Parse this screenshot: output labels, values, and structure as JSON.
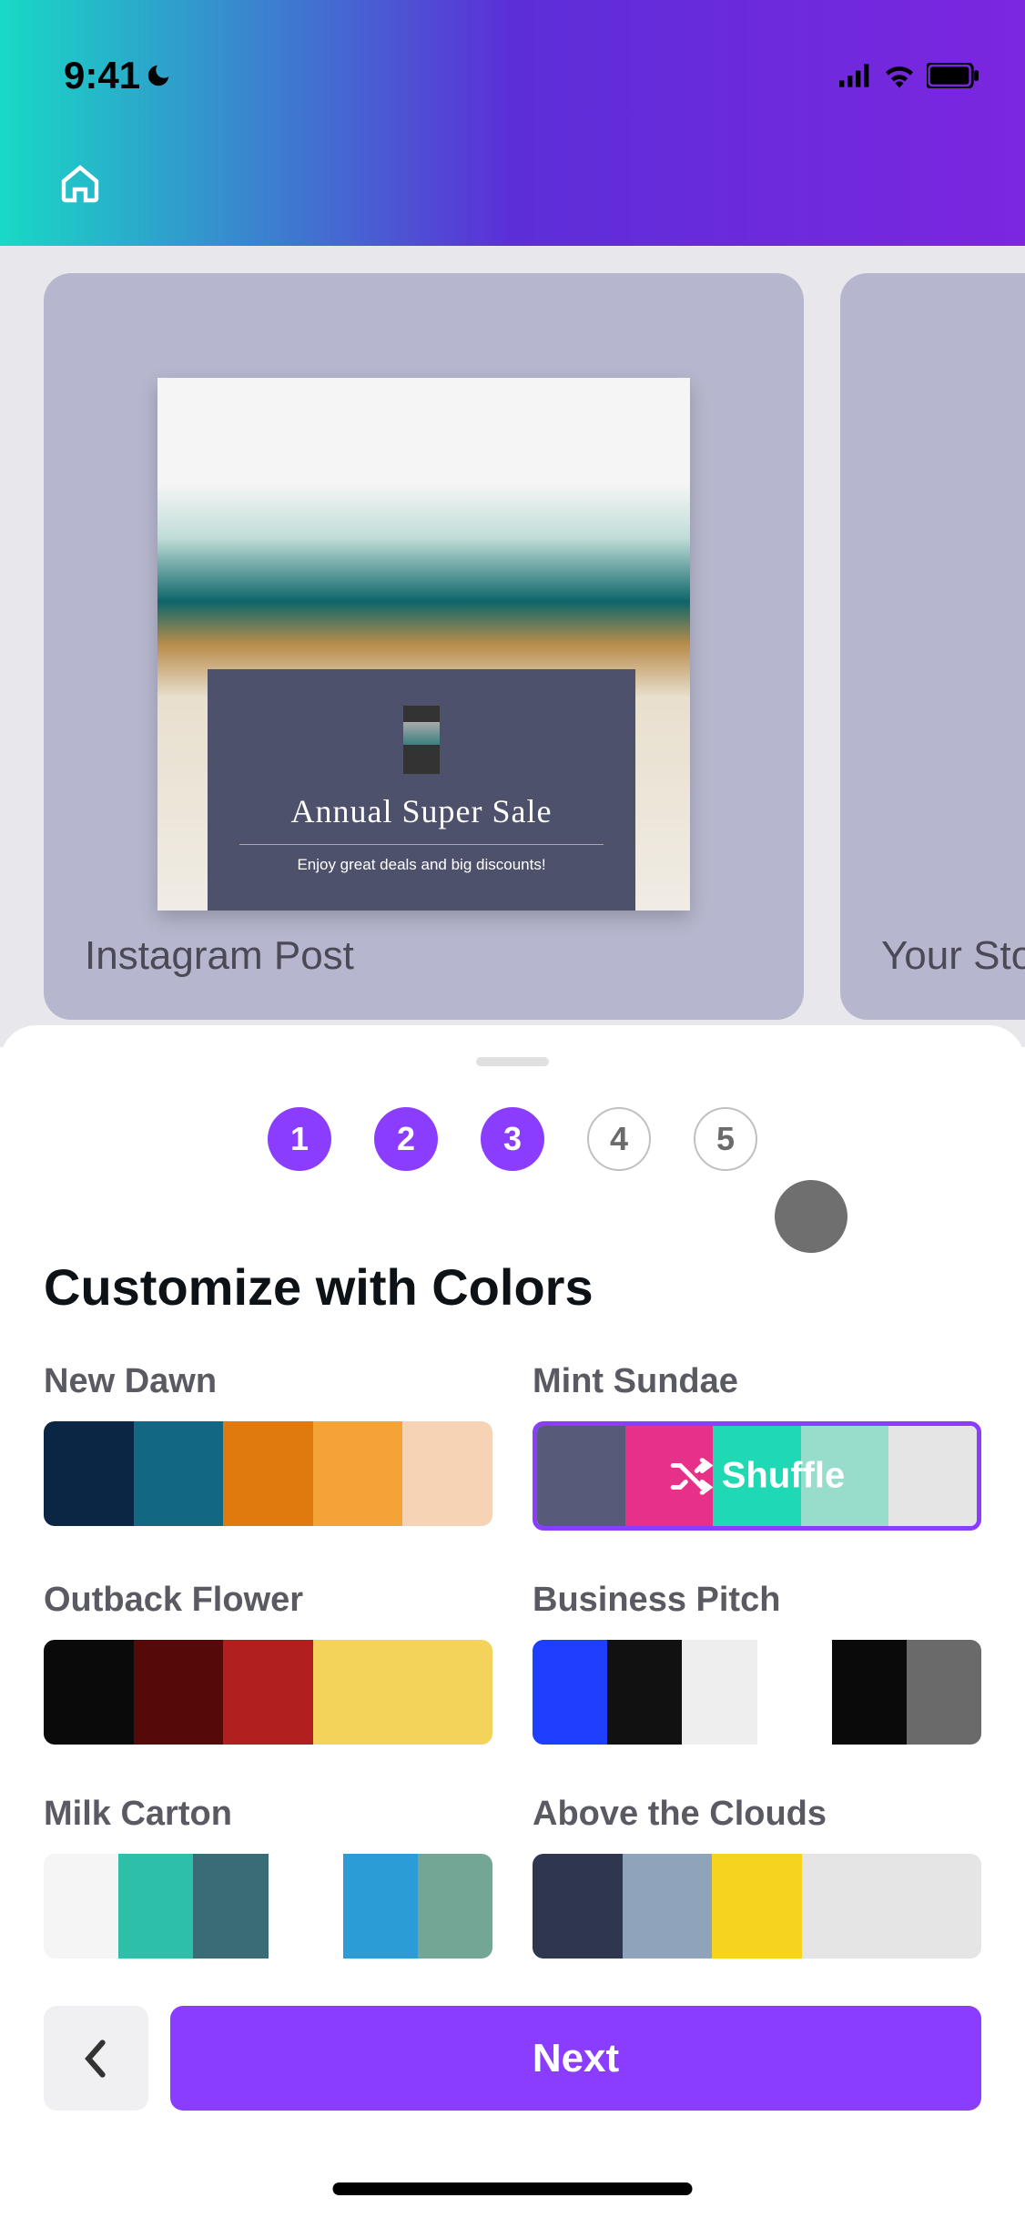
{
  "status": {
    "time": "9:41"
  },
  "templates": {
    "card1": {
      "title": "Annual Super Sale",
      "subtitle": "Enjoy great deals and big discounts!",
      "label": "Instagram Post"
    },
    "card2": {
      "label": "Your Sto"
    }
  },
  "steps": [
    "1",
    "2",
    "3",
    "4",
    "5"
  ],
  "sheet": {
    "title": "Customize with Colors",
    "shuffle_label": "Shuffle"
  },
  "palettes": [
    {
      "name": "New Dawn",
      "colors": [
        "#0b2545",
        "#126782",
        "#e07a0e",
        "#f4a336",
        "#f6d3b5"
      ]
    },
    {
      "name": "Mint Sundae",
      "colors": [
        "#555b78",
        "#e73189",
        "#1ed9b3",
        "#98dccb",
        "#e5e5e5"
      ],
      "selected": true
    },
    {
      "name": "Outback Flower",
      "colors": [
        "#0a0a0a",
        "#560909",
        "#b21f1f",
        "#f3d35a",
        "#f3d35a"
      ]
    },
    {
      "name": "Business Pitch",
      "colors": [
        "#1f3fff",
        "#111111",
        "#eeeeee",
        "#ffffff",
        "#0a0a0a",
        "#6a6a6a"
      ]
    },
    {
      "name": "Milk Carton",
      "colors": [
        "#f5f5f5",
        "#2dbfa8",
        "#3a6c76",
        "#ffffff",
        "#2c9cd6",
        "#73a695"
      ]
    },
    {
      "name": "Above the Clouds",
      "colors": [
        "#2e374e",
        "#8fa3ba",
        "#f5d31f",
        "#e5e5e5",
        "#e5e5e5"
      ]
    }
  ],
  "buttons": {
    "next": "Next"
  }
}
